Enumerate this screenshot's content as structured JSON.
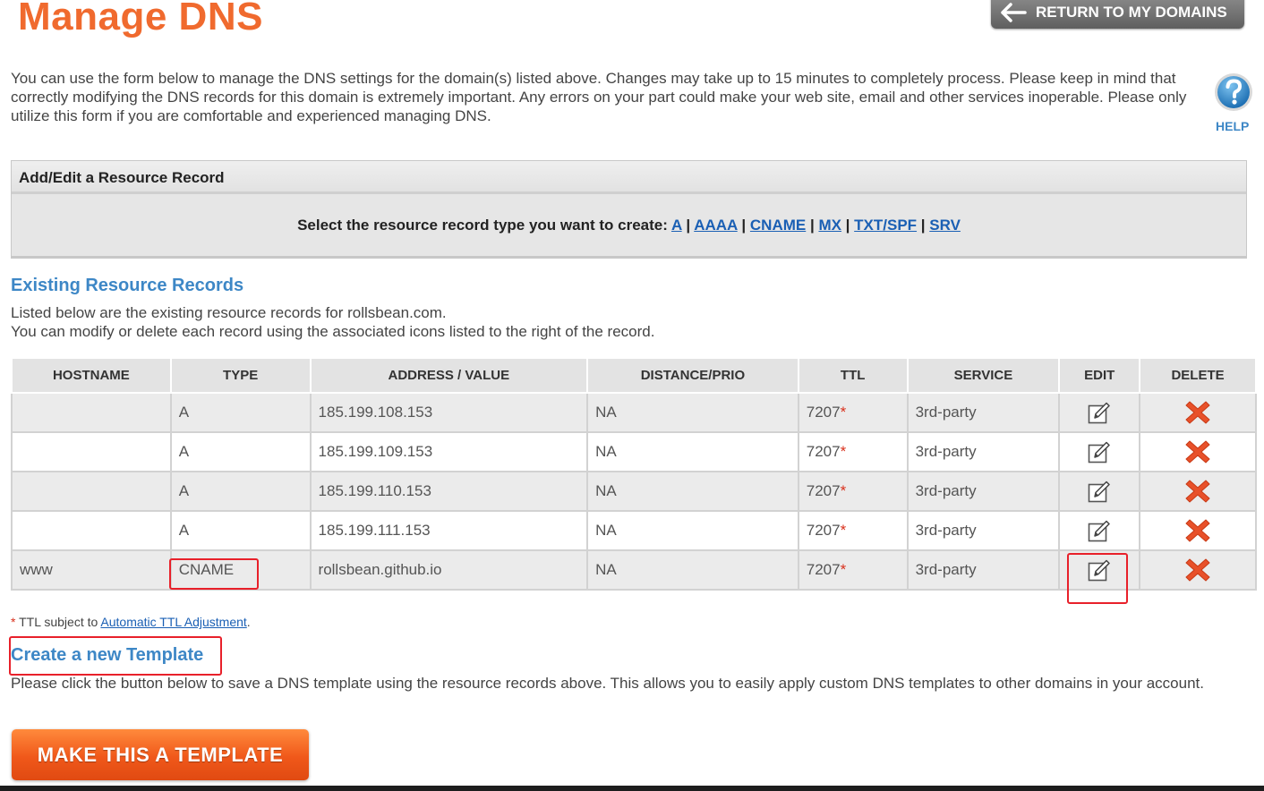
{
  "header": {
    "title": "Manage DNS",
    "return_button": "RETURN TO MY DOMAINS"
  },
  "intro": "You can use the form below to manage the DNS settings for the domain(s) listed above. Changes may take up to 15 minutes to completely process. Please keep in mind that correctly modifying the DNS records for this domain is extremely important. Any errors on your part could make your web site, email and other services inoperable. Please only utilize this form if you are comfortable and experienced managing DNS.",
  "help": {
    "label": "HELP"
  },
  "add_panel": {
    "header": "Add/Edit a Resource Record",
    "prompt": "Select the resource record type you want to create:",
    "types": [
      "A",
      "AAAA",
      "CNAME",
      "MX",
      "TXT/SPF",
      "SRV"
    ]
  },
  "existing": {
    "title": "Existing Resource Records",
    "desc_line1": "Listed below are the existing resource records for rollsbean.com.",
    "desc_line2": "You can modify or delete each record using the associated icons listed to the right of the record."
  },
  "table": {
    "headers": [
      "HOSTNAME",
      "TYPE",
      "ADDRESS / VALUE",
      "DISTANCE/PRIO",
      "TTL",
      "SERVICE",
      "EDIT",
      "DELETE"
    ],
    "rows": [
      {
        "hostname": "",
        "type": "A",
        "value": "185.199.108.153",
        "prio": "NA",
        "ttl": "7207",
        "service": "3rd-party"
      },
      {
        "hostname": "",
        "type": "A",
        "value": "185.199.109.153",
        "prio": "NA",
        "ttl": "7207",
        "service": "3rd-party"
      },
      {
        "hostname": "",
        "type": "A",
        "value": "185.199.110.153",
        "prio": "NA",
        "ttl": "7207",
        "service": "3rd-party"
      },
      {
        "hostname": "",
        "type": "A",
        "value": "185.199.111.153",
        "prio": "NA",
        "ttl": "7207",
        "service": "3rd-party"
      },
      {
        "hostname": "www",
        "type": "CNAME",
        "value": "rollsbean.github.io",
        "prio": "NA",
        "ttl": "7207",
        "service": "3rd-party"
      }
    ],
    "ttl_marker": "*"
  },
  "ttl_note": {
    "star": "*",
    "text": " TTL subject to ",
    "link": "Automatic TTL Adjustment",
    "end": "."
  },
  "template": {
    "title": "Create a new Template",
    "desc": "Please click the button below to save a DNS template using the resource records above. This allows you to easily apply custom DNS templates to other domains in your account.",
    "button": "MAKE THIS A TEMPLATE"
  },
  "colors": {
    "title_orange": "#f06a2e",
    "link_blue": "#3d87c6",
    "highlight_red": "#e8202a",
    "delete_red": "#e8512a"
  }
}
